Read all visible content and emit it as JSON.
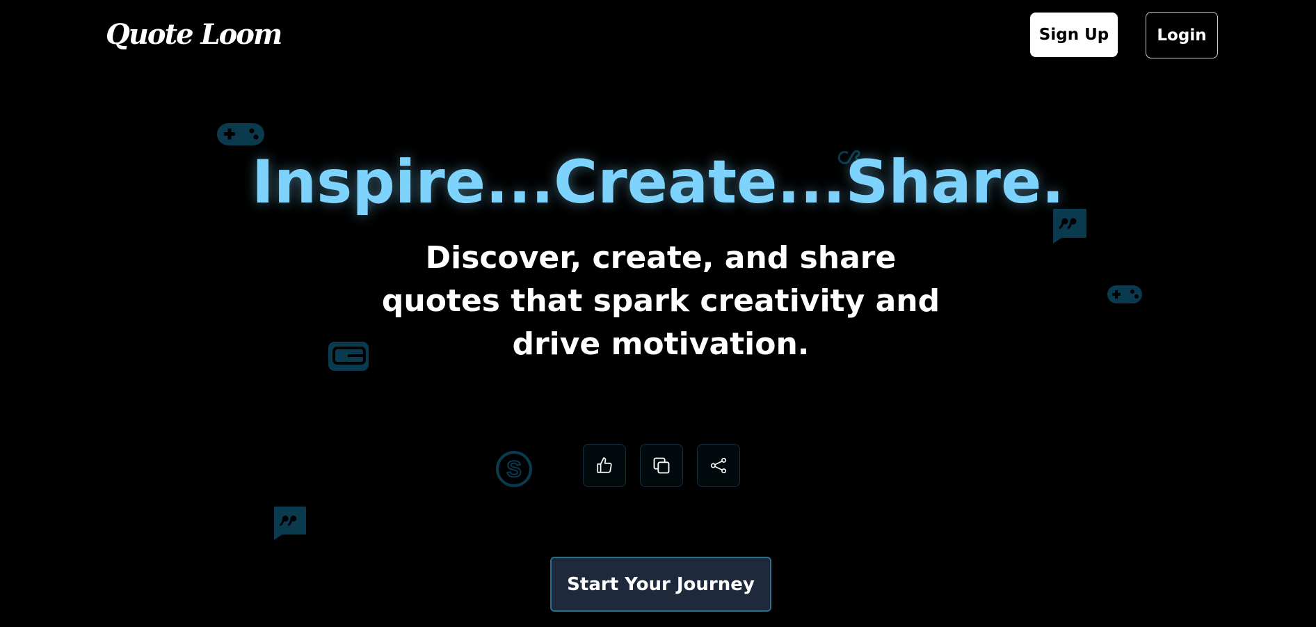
{
  "brand": {
    "logo_text": "Quote Loom"
  },
  "nav": {
    "signup_label": "Sign Up",
    "login_label": "Login"
  },
  "hero": {
    "headline": "Inspire...Create...Share.",
    "subheadline": "Discover, create, and share quotes that spark creativity and drive motivation."
  },
  "actions": [
    {
      "icon": "thumbs-up-icon"
    },
    {
      "icon": "copy-icon"
    },
    {
      "icon": "share-icon"
    }
  ],
  "cta": {
    "label": "Start Your Journey"
  },
  "colors": {
    "background": "#000000",
    "accent": "#7dd3fc",
    "cta_bg": "#1e293b",
    "cta_border": "#2a6f8f",
    "deco_icon": "#0a3a4d"
  },
  "decorative_icons": [
    "gamepad-icon",
    "lastfm-icon",
    "quote-bubble-icon",
    "gamepad-icon",
    "gameloft-icon",
    "skype-icon",
    "quote-bubble-icon"
  ]
}
